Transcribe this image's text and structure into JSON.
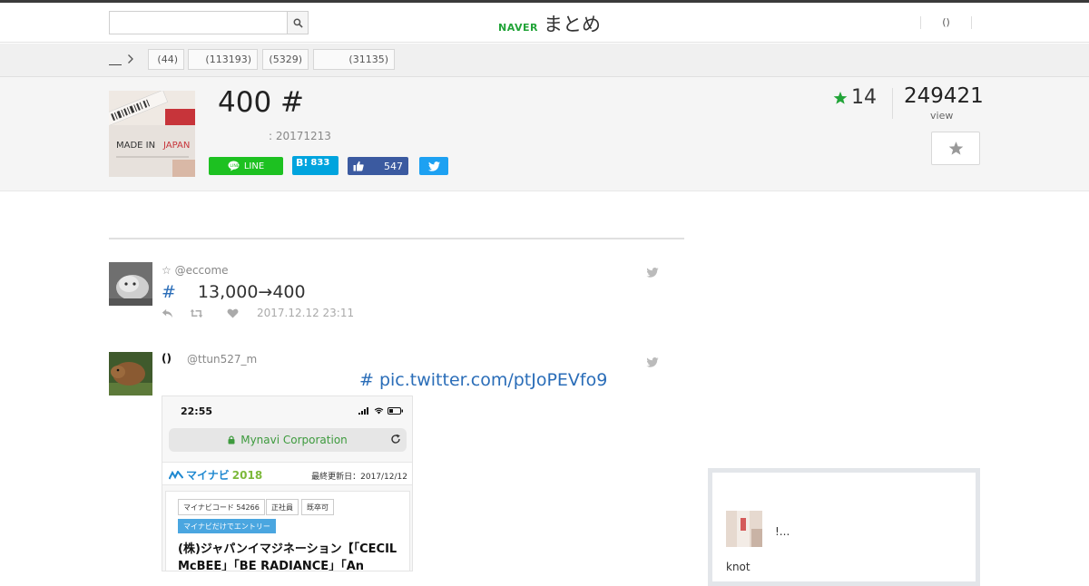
{
  "header": {
    "search_placeholder": "",
    "logo_naver": "NAVER",
    "logo_matome": "まとめ",
    "user_menu": "()"
  },
  "categories": {
    "items": [
      {
        "label": "(44)"
      },
      {
        "label": "(113193)"
      },
      {
        "label": "(5329)"
      },
      {
        "label": "(31135)"
      }
    ]
  },
  "article": {
    "title": "400 #",
    "date": ": 20171213",
    "thumbnail_text_1": "MADE IN",
    "thumbnail_text_2": "JAPAN",
    "fav_count": "14",
    "view_count": "249421",
    "view_label": "view"
  },
  "share": {
    "line_label": "LINE",
    "hatena_mark": "B!",
    "hatena_count": "833",
    "facebook_count": "547"
  },
  "tweets": [
    {
      "name": "☆ @eccome",
      "hashtag": "#",
      "text": "13,000→400",
      "timestamp": "2017.12.12 23:11"
    },
    {
      "name": "()",
      "handle": "@ttun527_m",
      "link": "# pic.twitter.com/ptJoPEVfo9"
    }
  ],
  "screenshot": {
    "time": "22:55",
    "url": "Mynavi Corporation",
    "brand": "マイナビ",
    "brand_year": "2018",
    "updated": "最終更新日：2017/12/12",
    "tags": [
      "マイナビコード 54266",
      "正社員",
      "既卒可"
    ],
    "entry": "マイナビだけでエントリー",
    "company": "(株)ジャパンイマジネーション【「CECIL McBEE」「BE RADIANCE」「An"
  },
  "sidebar": {
    "title": "!...",
    "sub": "knot"
  },
  "colors": {
    "line_green": "#1dc121",
    "hatena_blue": "#00a4de",
    "facebook_blue": "#3b5aa0",
    "twitter_blue": "#1da1f2",
    "star_green": "#22a438",
    "link_blue": "#2a6db8"
  }
}
